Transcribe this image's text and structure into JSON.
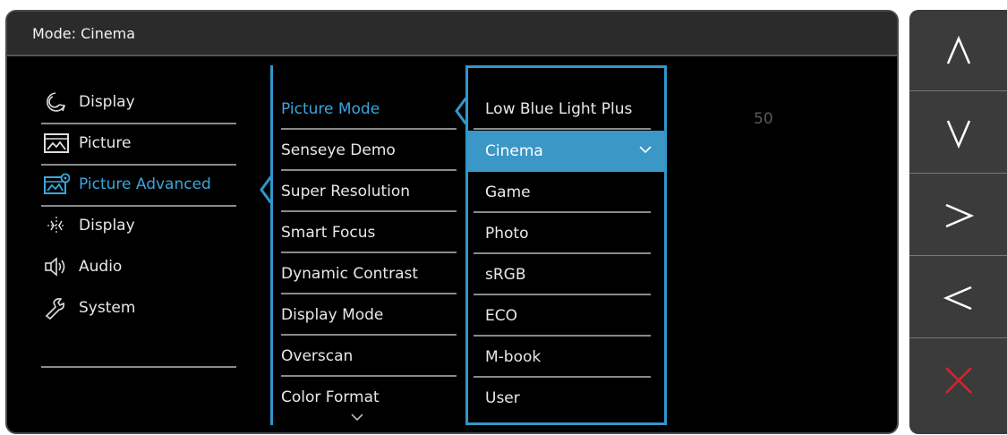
{
  "header": {
    "mode_label": "Mode: Cinema"
  },
  "categories": [
    {
      "label": "Display",
      "icon": "display-icon"
    },
    {
      "label": "Picture",
      "icon": "picture-icon"
    },
    {
      "label": "Picture Advanced",
      "icon": "picture-advanced-icon",
      "active": true
    },
    {
      "label": "Display",
      "icon": "display-adjust-icon"
    },
    {
      "label": "Audio",
      "icon": "audio-icon"
    },
    {
      "label": "System",
      "icon": "system-icon"
    }
  ],
  "submenu": [
    {
      "label": "Picture Mode",
      "active": true
    },
    {
      "label": "Senseye Demo"
    },
    {
      "label": "Super Resolution"
    },
    {
      "label": "Smart Focus"
    },
    {
      "label": "Dynamic Contrast"
    },
    {
      "label": "Display Mode"
    },
    {
      "label": "Overscan"
    },
    {
      "label": "Color Format"
    }
  ],
  "options": [
    {
      "label": "Low Blue Light Plus"
    },
    {
      "label": "Cinema",
      "selected": true
    },
    {
      "label": "Game"
    },
    {
      "label": "Photo"
    },
    {
      "label": "sRGB"
    },
    {
      "label": "ECO"
    },
    {
      "label": "M-book"
    },
    {
      "label": "User"
    }
  ],
  "value_display": "50",
  "side_buttons": [
    {
      "icon": "up-arrow-icon"
    },
    {
      "icon": "down-arrow-icon"
    },
    {
      "icon": "right-arrow-icon"
    },
    {
      "icon": "left-arrow-icon"
    },
    {
      "icon": "close-icon",
      "color": "#e0202a"
    }
  ],
  "colors": {
    "accent": "#3196cc",
    "selected_bg": "#3a97c6",
    "close": "#e0202a"
  }
}
